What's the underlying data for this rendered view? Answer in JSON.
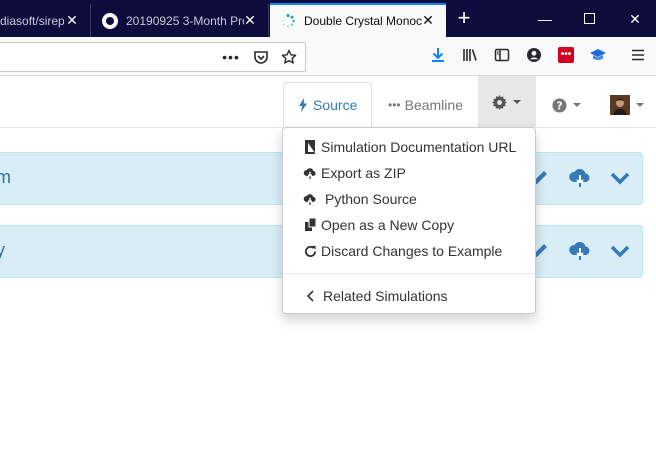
{
  "browser": {
    "tabs": [
      {
        "title": "diasoft/sirep"
      },
      {
        "title": "20190925 3-Month Pro"
      },
      {
        "title": "Double Crystal Monoc"
      }
    ]
  },
  "app": {
    "nav": {
      "source_label": "Source",
      "beamline_label": "Beamline"
    },
    "panels": [
      {
        "title": "m"
      },
      {
        "title": "y"
      }
    ],
    "dropdown": {
      "items": [
        {
          "label": "Simulation Documentation URL",
          "icon": "book-icon"
        },
        {
          "label": "Export as ZIP",
          "icon": "cloud-download-icon"
        },
        {
          "label": "Python Source",
          "icon": "cloud-download-icon"
        },
        {
          "label": "Open as a New Copy",
          "icon": "copy-icon"
        },
        {
          "label": "Discard Changes to Example",
          "icon": "refresh-icon"
        }
      ],
      "related_label": "Related Simulations"
    },
    "colors": {
      "tabbar_bg": "#0c0c3d",
      "panel_bg": "#d9edf7",
      "accent": "#337ab7",
      "download_blue": "#0a84ff",
      "extension_red": "#d70022"
    }
  }
}
